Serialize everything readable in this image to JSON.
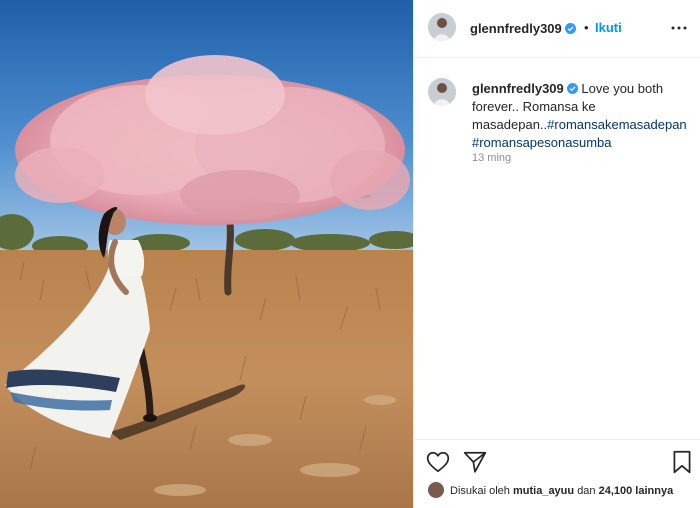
{
  "post": {
    "header": {
      "username": "glennfredly309",
      "separator": "•",
      "follow_label": "Ikuti"
    },
    "caption": {
      "username": "glennfredly309",
      "text": "Love you both forever.. Romansa ke masadepan..",
      "hashtag_1": "#romansakemasadepan",
      "hashtag_2": "#romansapesonasumba",
      "timestamp": "13 ming"
    },
    "likes": {
      "prefix": "Disukai oleh",
      "liker": "mutia_ayuu",
      "middle": "dan",
      "count": "24,100 lainnya"
    }
  },
  "icons": {
    "more": "more-horizontal-icon",
    "like": "heart-icon",
    "share": "paper-plane-icon",
    "save": "bookmark-icon",
    "verified": "verified-badge-icon"
  },
  "colors": {
    "follow": "#0095f6",
    "hashtag": "#00376b",
    "muted": "#8e8e8e",
    "border": "#efefef"
  }
}
